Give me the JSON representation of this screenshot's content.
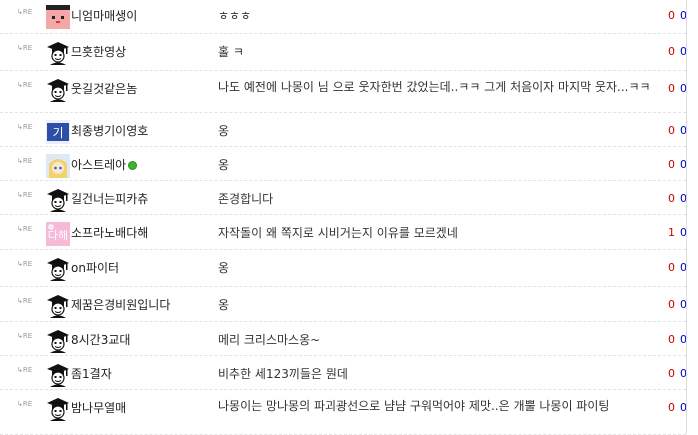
{
  "re_label": "RE",
  "colors": {
    "count_red": "#cc0000",
    "count_blue": "#0000cc"
  },
  "comments": [
    {
      "name": "니엄마매생이",
      "text": "ㅎㅎㅎ",
      "c1": "0",
      "c2": "0",
      "avatar": "pink-face-avatar"
    },
    {
      "name": "므흣한영상",
      "text": "홀 ㅋ",
      "c1": "0",
      "c2": "0",
      "avatar": "graduate-cap-icon"
    },
    {
      "name": "웃길것같은놈",
      "text": "나도 예전에 나몽이 님 으로 웃자한번 갔었는데..ㅋㅋ 그게 처음이자 마지막 웃자...ㅋㅋ",
      "c1": "0",
      "c2": "0",
      "avatar": "graduate-cap-icon"
    },
    {
      "name": "최종병기이영호",
      "text": "옹",
      "c1": "0",
      "c2": "0",
      "avatar": "blue-text-avatar"
    },
    {
      "name": "아스트레아",
      "text": "옹",
      "c1": "0",
      "c2": "0",
      "avatar": "anime-girl-avatar",
      "online": true
    },
    {
      "name": "길건너는피카츄",
      "text": "존경합니다",
      "c1": "0",
      "c2": "0",
      "avatar": "graduate-cap-icon"
    },
    {
      "name": "소프라노배다해",
      "text": "자작돌이 왜 쪽지로 시비거는지 이유를 모르겠네",
      "c1": "1",
      "c2": "0",
      "avatar": "pink-text-avatar"
    },
    {
      "name": "on파이터",
      "text": "옹",
      "c1": "0",
      "c2": "0",
      "avatar": "graduate-cap-icon"
    },
    {
      "name": "제꿈은경비원입니다",
      "text": "옹",
      "c1": "0",
      "c2": "0",
      "avatar": "graduate-cap-icon"
    },
    {
      "name": "8시간3교대",
      "text": "메리 크리스마스옹~",
      "c1": "0",
      "c2": "0",
      "avatar": "graduate-cap-icon"
    },
    {
      "name": "좀1결자",
      "text": "비추한 세123끼들은 뭔데",
      "c1": "0",
      "c2": "0",
      "avatar": "graduate-cap-icon"
    },
    {
      "name": "밤나무열매",
      "text": "나몽이는 망나몽의 파괴광선으로 냠냠 구워먹어야 제맛..은 개뿔 나몽이 파이팅",
      "c1": "0",
      "c2": "0",
      "avatar": "graduate-cap-icon"
    }
  ]
}
